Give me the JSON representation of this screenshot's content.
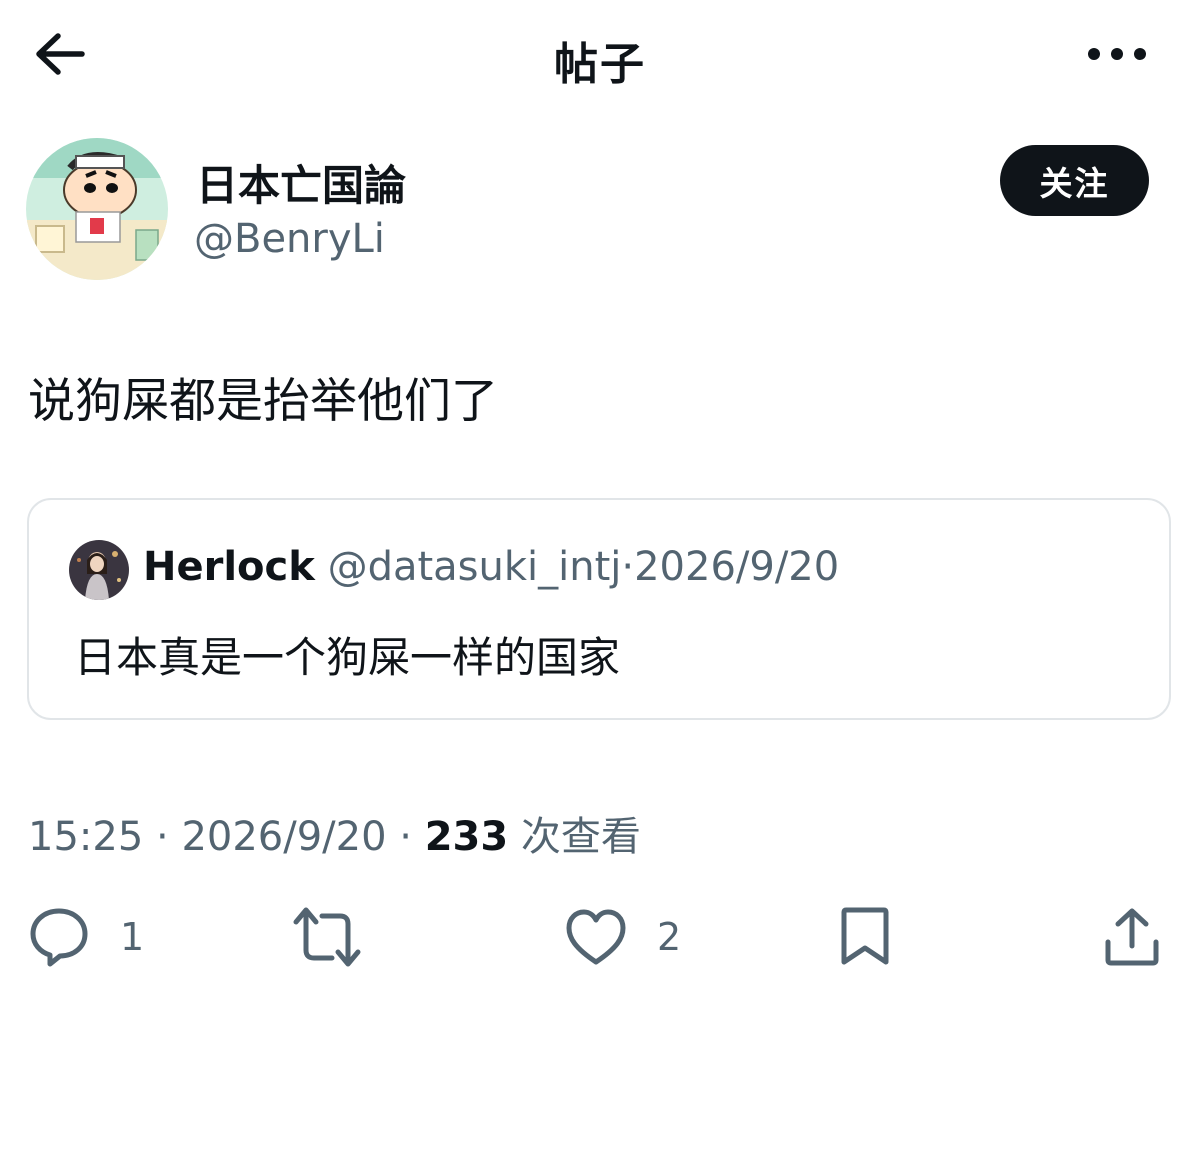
{
  "header": {
    "title": "帖子",
    "back_icon": "arrow-left-icon",
    "more_icon": "more-horizontal-icon"
  },
  "author": {
    "name": "日本亡国論",
    "handle": "@BenryLi",
    "follow_label": "关注"
  },
  "post": {
    "text": "说狗屎都是抬举他们了"
  },
  "quote": {
    "name": "Herlock",
    "handle": "@datasuki_intj",
    "separator": "·",
    "date": "2026/9/20",
    "text": "日本真是一个狗屎一样的国家"
  },
  "meta": {
    "time": "15:25",
    "separator": "·",
    "date": "2026/9/20",
    "views_count": "233",
    "views_label": "次查看"
  },
  "actions": {
    "reply_count": "1",
    "repost_count": "",
    "like_count": "2"
  },
  "colors": {
    "text": "#0f1419",
    "secondary": "#536471",
    "border": "#e1e5e8",
    "button_bg": "#0f1419"
  }
}
